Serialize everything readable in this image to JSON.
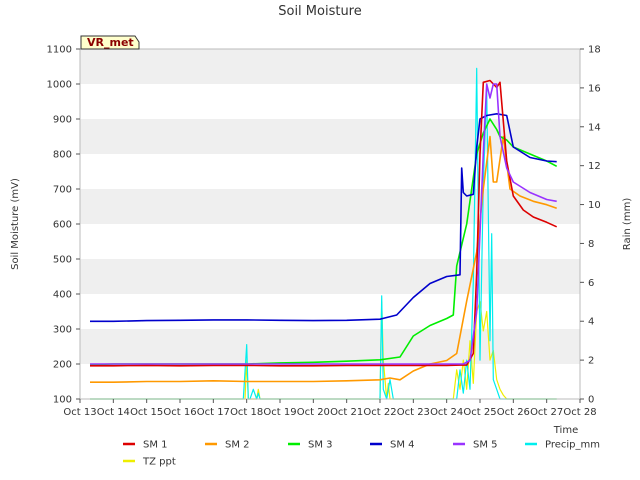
{
  "chart_data": {
    "type": "line",
    "title": "Soil Moisture",
    "badge": "VR_met",
    "xlabel": "Time",
    "ylabel_left": "Soil Moisture (mV)",
    "ylabel_right": "Rain (mm)",
    "x_ticks": [
      "Oct 13",
      "Oct 14",
      "Oct 15",
      "Oct 16",
      "Oct 17",
      "Oct 18",
      "Oct 19",
      "Oct 20",
      "Oct 21",
      "Oct 22",
      "Oct 23",
      "Oct 24",
      "Oct 25",
      "Oct 26",
      "Oct 27",
      "Oct 28"
    ],
    "x_range": [
      13,
      28
    ],
    "ylim_left": [
      100,
      1100
    ],
    "y_ticks_left": [
      100,
      200,
      300,
      400,
      500,
      600,
      700,
      800,
      900,
      1000,
      1100
    ],
    "ylim_right": [
      0,
      18
    ],
    "y_ticks_right": [
      0,
      2,
      4,
      6,
      8,
      10,
      12,
      14,
      16,
      18
    ],
    "grid": "horizontal bands",
    "legend_position": "bottom",
    "colors": {
      "SM 1": "#dd0000",
      "SM 2": "#ff9900",
      "SM 3": "#00ee00",
      "SM 4": "#0000cc",
      "SM 5": "#9933ff",
      "Precip_mm": "#00eeee",
      "TZ ppt": "#eeee00"
    },
    "series": [
      {
        "name": "SM 1",
        "axis": "left",
        "x": [
          13.3,
          14,
          15,
          16,
          17,
          18,
          19,
          20,
          21,
          22,
          23,
          24,
          24.4,
          24.6,
          24.8,
          24.9,
          25.0,
          25.1,
          25.3,
          25.5,
          25.6,
          25.8,
          26,
          26.3,
          26.6,
          27,
          27.3
        ],
        "y": [
          195,
          195,
          196,
          195,
          196,
          196,
          195,
          195,
          196,
          196,
          196,
          196,
          197,
          197,
          230,
          460,
          800,
          1005,
          1010,
          990,
          1005,
          780,
          680,
          640,
          620,
          605,
          592
        ]
      },
      {
        "name": "SM 2",
        "axis": "left",
        "x": [
          13.3,
          14,
          15,
          16,
          17,
          18,
          19,
          20,
          21,
          22,
          22.3,
          22.6,
          23,
          23.5,
          24,
          24.3,
          24.6,
          24.9,
          25.1,
          25.3,
          25.4,
          25.5,
          25.7,
          25.9,
          26.2,
          26.6,
          27,
          27.3
        ],
        "y": [
          148,
          148,
          150,
          150,
          152,
          150,
          150,
          150,
          152,
          155,
          160,
          155,
          180,
          200,
          210,
          230,
          380,
          520,
          700,
          850,
          720,
          720,
          850,
          700,
          680,
          665,
          655,
          645
        ]
      },
      {
        "name": "SM 3",
        "axis": "left",
        "x": [
          13.3,
          14,
          15,
          16,
          17,
          18,
          19,
          20,
          21,
          22,
          22.6,
          23,
          23.5,
          24,
          24.2,
          24.3,
          24.6,
          24.9,
          25.1,
          25.3,
          25.5,
          25.6,
          25.8,
          26,
          26.5,
          27,
          27.3
        ],
        "y": [
          198,
          200,
          200,
          200,
          200,
          200,
          203,
          205,
          208,
          212,
          220,
          280,
          310,
          330,
          340,
          480,
          600,
          800,
          860,
          900,
          870,
          850,
          840,
          820,
          800,
          780,
          765
        ]
      },
      {
        "name": "SM 4",
        "axis": "left",
        "x": [
          13.3,
          14,
          15,
          16,
          17,
          18,
          19,
          20,
          21,
          22,
          22.5,
          23,
          23.5,
          24,
          24.4,
          24.45,
          24.5,
          24.6,
          24.8,
          24.9,
          25.0,
          25.2,
          25.5,
          25.8,
          26,
          26.5,
          27,
          27.3
        ],
        "y": [
          322,
          322,
          324,
          325,
          326,
          326,
          325,
          324,
          325,
          328,
          340,
          390,
          430,
          450,
          455,
          760,
          690,
          680,
          685,
          820,
          900,
          910,
          915,
          910,
          820,
          790,
          780,
          778
        ]
      },
      {
        "name": "SM 5",
        "axis": "left",
        "x": [
          13.3,
          14,
          15,
          16,
          17,
          18,
          19,
          20,
          21,
          22,
          23,
          24,
          24.5,
          24.7,
          24.9,
          25.1,
          25.2,
          25.3,
          25.4,
          25.5,
          25.6,
          25.8,
          26,
          26.5,
          27,
          27.3
        ],
        "y": [
          200,
          200,
          200,
          200,
          200,
          200,
          200,
          200,
          200,
          200,
          200,
          200,
          200,
          210,
          350,
          800,
          1000,
          960,
          1000,
          1000,
          850,
          760,
          720,
          690,
          670,
          665
        ]
      },
      {
        "name": "Precip_mm",
        "axis": "right",
        "x": [
          13.3,
          17.9,
          18.0,
          18.05,
          18.1,
          18.2,
          18.3,
          18.35,
          18.4,
          22.0,
          22.05,
          22.1,
          22.2,
          22.3,
          22.4,
          22.5,
          24.3,
          24.4,
          24.5,
          24.6,
          24.7,
          24.8,
          24.9,
          25.0,
          25.1,
          25.2,
          25.3,
          25.35,
          25.4,
          25.5,
          25.6,
          25.7,
          25.8,
          25.9,
          26.0,
          27.3
        ],
        "y": [
          0,
          0,
          2.8,
          0,
          0,
          0.5,
          0,
          0.3,
          0,
          0,
          5.3,
          0.5,
          0,
          1,
          0,
          0,
          0,
          1.5,
          0.3,
          2,
          0.5,
          6,
          17,
          2,
          11,
          16,
          3,
          8.5,
          1,
          0.5,
          0,
          0,
          0,
          0,
          0,
          0
        ]
      },
      {
        "name": "TZ ppt",
        "axis": "right",
        "x": [
          13.3,
          17.9,
          17.95,
          18.0,
          18.05,
          18.1,
          18.3,
          18.35,
          18.4,
          21.9,
          22.0,
          22.05,
          22.1,
          22.2,
          22.25,
          22.3,
          22.5,
          24.2,
          24.3,
          24.4,
          24.5,
          24.6,
          24.7,
          24.8,
          24.9,
          25.0,
          25.1,
          25.2,
          25.3,
          25.4,
          25.5,
          25.6,
          25.7,
          25.8,
          27.3
        ],
        "y": [
          0,
          0,
          0,
          2,
          0,
          0,
          0,
          0.5,
          0,
          0,
          0,
          5,
          2,
          0,
          0.8,
          0,
          0,
          0,
          1.5,
          0.5,
          2,
          0.5,
          3,
          0.8,
          4.5,
          5,
          3.5,
          4.5,
          2,
          2.5,
          1,
          0.5,
          0.2,
          0,
          0
        ]
      }
    ]
  }
}
